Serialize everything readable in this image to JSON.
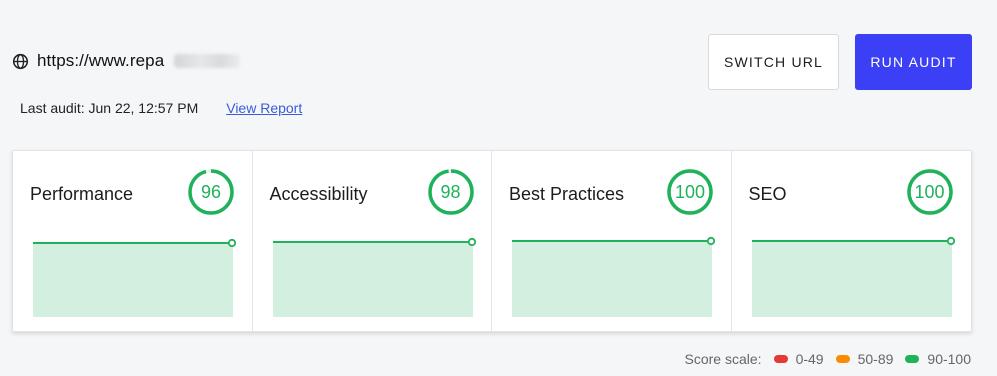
{
  "header": {
    "url": "https://www.repa",
    "last_audit": "Last audit: Jun 22, 12:57 PM",
    "view_report": "View Report"
  },
  "buttons": {
    "switch_url": "SWITCH URL",
    "run_audit": "RUN AUDIT"
  },
  "cards": [
    {
      "title": "Performance",
      "score": "96",
      "score_value": 96
    },
    {
      "title": "Accessibility",
      "score": "98",
      "score_value": 98
    },
    {
      "title": "Best Practices",
      "score": "100",
      "score_value": 100
    },
    {
      "title": "SEO",
      "score": "100",
      "score_value": 100
    }
  ],
  "legend": {
    "label": "Score scale:",
    "items": [
      {
        "range": "0-49",
        "color": "#e53935"
      },
      {
        "range": "50-89",
        "color": "#fb8c00"
      },
      {
        "range": "90-100",
        "color": "#1fb25a"
      }
    ]
  },
  "colors": {
    "accent": "#3b3ff6",
    "pass": "#1fb25a",
    "pass_fill": "#d2efdf",
    "link": "#3b5bdb"
  }
}
